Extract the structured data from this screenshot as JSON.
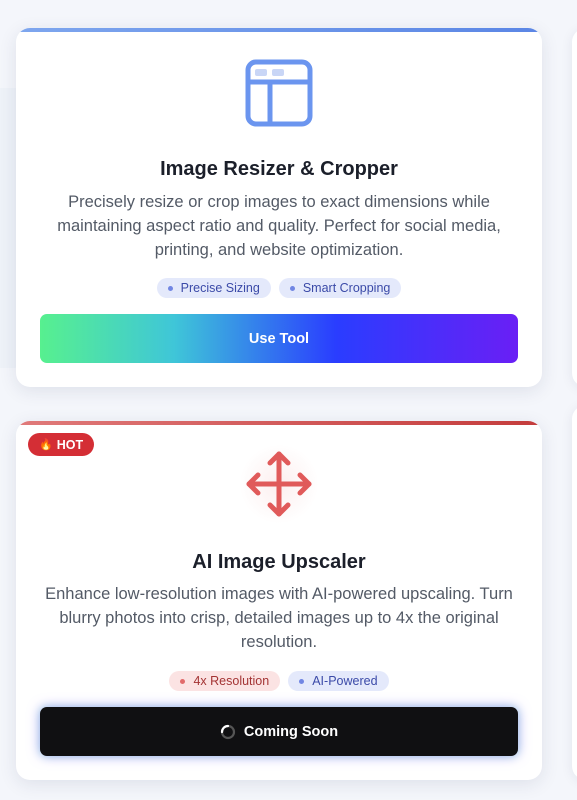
{
  "tools": [
    {
      "title": "Image Resizer & Cropper",
      "description": "Precisely resize or crop images to exact dimensions while maintaining aspect ratio and quality. Perfect for social media, printing, and website optimization.",
      "tags": [
        "Precise Sizing",
        "Smart Cropping"
      ],
      "button_label": "Use Tool",
      "icon": "layout-window-icon",
      "accent_color": "#5b86e5"
    },
    {
      "badge": "HOT",
      "badge_icon": "fire-icon",
      "title": "AI Image Upscaler",
      "description": "Enhance low-resolution images with AI-powered upscaling. Turn blurry photos into crisp, detailed images up to 4x the original resolution.",
      "tags": [
        "4x Resolution",
        "AI-Powered"
      ],
      "button_label": "Coming Soon",
      "icon": "move-arrows-icon",
      "accent_color": "#e05a5a"
    }
  ]
}
